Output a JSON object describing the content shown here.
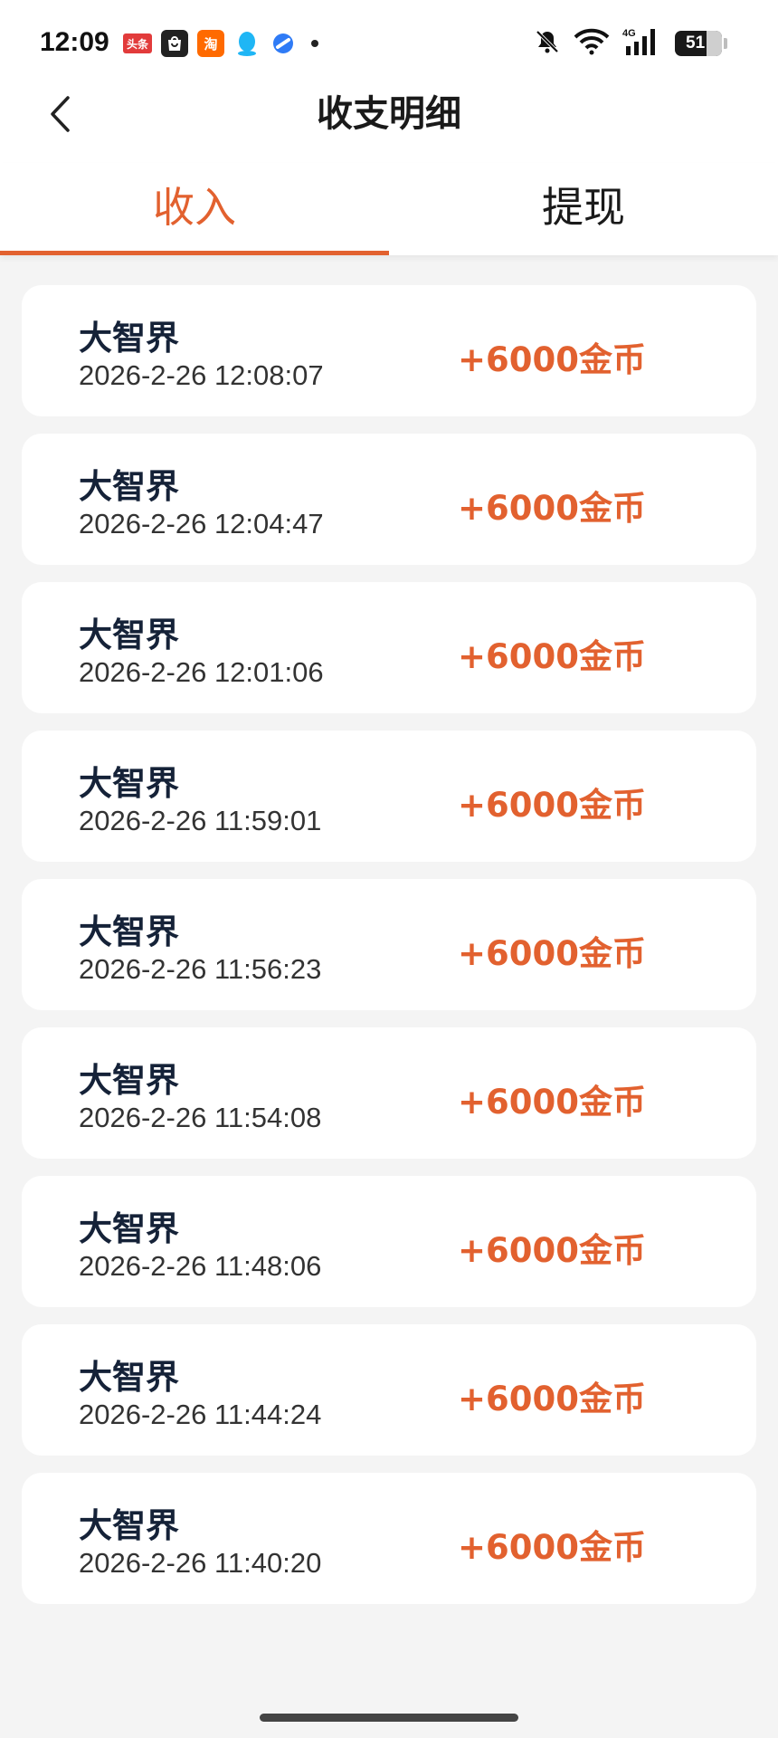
{
  "status_bar": {
    "time": "12:09",
    "notification_icons": [
      "toutiao-icon",
      "shopping-bag-icon",
      "taobao-icon",
      "qq-icon",
      "browser-icon"
    ],
    "toutiao_label": "头条",
    "taobao_label": "淘",
    "battery_level": "51",
    "network": "4G"
  },
  "header": {
    "title": "收支明细"
  },
  "tabs": [
    {
      "label": "收入",
      "active": true
    },
    {
      "label": "提现",
      "active": false
    }
  ],
  "records": [
    {
      "name": "大智界",
      "time": "2026-2-26 12:08:07",
      "amount": "+6000金币"
    },
    {
      "name": "大智界",
      "time": "2026-2-26 12:04:47",
      "amount": "+6000金币"
    },
    {
      "name": "大智界",
      "time": "2026-2-26 12:01:06",
      "amount": "+6000金币"
    },
    {
      "name": "大智界",
      "time": "2026-2-26 11:59:01",
      "amount": "+6000金币"
    },
    {
      "name": "大智界",
      "time": "2026-2-26 11:56:23",
      "amount": "+6000金币"
    },
    {
      "name": "大智界",
      "time": "2026-2-26 11:54:08",
      "amount": "+6000金币"
    },
    {
      "name": "大智界",
      "time": "2026-2-26 11:48:06",
      "amount": "+6000金币"
    },
    {
      "name": "大智界",
      "time": "2026-2-26 11:44:24",
      "amount": "+6000金币"
    },
    {
      "name": "大智界",
      "time": "2026-2-26 11:40:20",
      "amount": "+6000金币"
    }
  ],
  "colors": {
    "accent": "#e2612f",
    "title_text": "#152238",
    "background": "#f4f4f4"
  }
}
